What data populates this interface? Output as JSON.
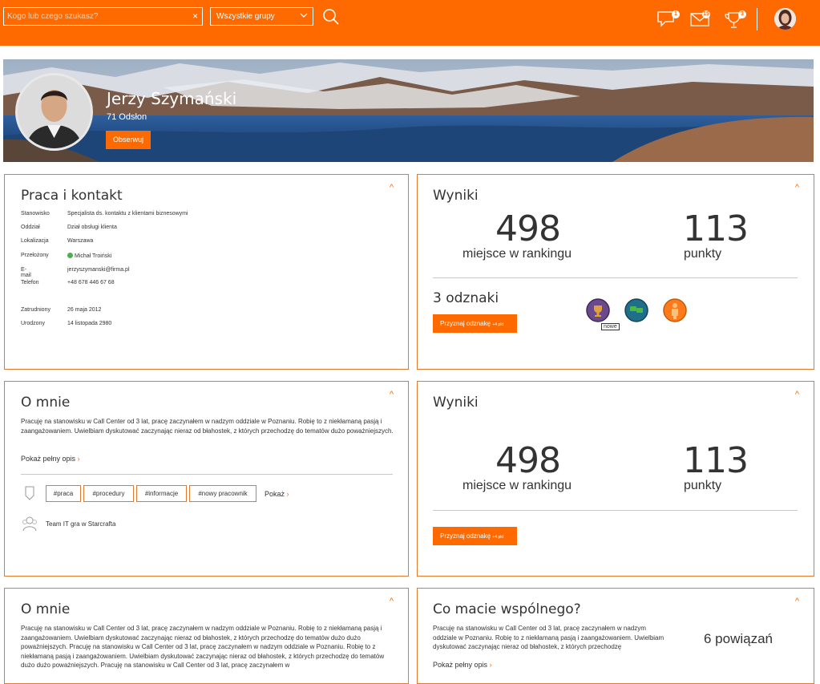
{
  "topbar": {
    "search_placeholder": "Kogo lub czego szukasz?",
    "clear_icon": "×",
    "group_select": "Wszystkie grupy",
    "chevron_icon": "⌄",
    "badges": {
      "comments": "1",
      "messages": "15",
      "trophy": "3"
    },
    "icons": [
      "search-icon",
      "comment-icon",
      "mail-icon",
      "trophy-icon",
      "avatar"
    ]
  },
  "profile": {
    "name": "Jerzy Szymański",
    "views": "71 Odsłon",
    "follow_label": "Obserwuj"
  },
  "work": {
    "title": "Praca i kontakt",
    "rows": [
      {
        "label": "Stanowisko",
        "value": "Specjalista ds. kontaktu z klientami biznesowymi"
      },
      {
        "label": "Oddział",
        "value": "Dział obsługi klienta"
      },
      {
        "label": "Lokalizacja",
        "value": "Warszawa"
      },
      {
        "label": "Przełożony",
        "value": "Michał Troiński"
      },
      {
        "label": "E-mail",
        "value": "jerzyszymanski@firma.pl"
      },
      {
        "label": "Telefon",
        "value": "+48 678 446 67 68"
      },
      {
        "label": "Zatrudniony",
        "value": "26 maja 2012"
      },
      {
        "label": "Urodzony",
        "value": "14 listopada 2980"
      }
    ]
  },
  "results1": {
    "title": "Wyniki",
    "rank_value": "498",
    "rank_label": "miejsce w rankingu",
    "points_value": "113",
    "points_label": "punkty",
    "badges_title": "3 odznaki",
    "grant_label": "Przyznaj odznakę",
    "grant_suffix": "+4 pkt",
    "new_label": "nowe",
    "colors": {
      "badge1": "#6a4a8c",
      "badge2": "#1f6f8b",
      "badge3": "#ff7a1a"
    }
  },
  "about1": {
    "title": "O mnie",
    "text": "Pracuję na stanowisku w Call Center od 3 lat, pracę zaczynałem w nadzym oddziale w Poznaniu. Robię to z niekłamaną pasją i zaangażowaniem. Uwielbiam dyskutować zaczynając nieraz od błahostek, z których przechodzę do tematów dużo poważniejszych.",
    "show_more": "Pokaż pełny opis",
    "tags": [
      "#praca",
      "#procedury",
      "#informacje",
      "#nowy pracownik"
    ],
    "tags_more": "Pokaż",
    "group": "Team IT gra w Starcrafta"
  },
  "results2": {
    "title": "Wyniki",
    "rank_value": "498",
    "rank_label": "miejsce w rankingu",
    "points_value": "113",
    "points_label": "punkty",
    "grant_label": "Przyznaj odznakę",
    "grant_suffix": "+4 pkt"
  },
  "about2": {
    "title": "O mnie",
    "text": "Pracuję na stanowisku w Call Center od 3 lat, pracę zaczynałem w nadzym oddziale w Poznaniu. Robię to z niekłamaną pasją i zaangażowaniem. Uwielbiam dyskutować zaczynając nieraz od błahostek, z których przechodzę do tematów dużo dużo poważniejszych. Pracuję na stanowisku w Call Center od 3 lat, pracę zaczynałem w nadzym oddziale w Poznaniu. Robię to z niekłamaną pasją i zaangażowaniem. Uwielbiam dyskutować zaczynając nieraz od błahostek, z których przechodzę do tematów dużo dużo poważniejszych. Pracuję na stanowisku w Call Center od 3 lat, pracę zaczynałem w"
  },
  "common": {
    "title": "Co macie wspólnego?",
    "text": "Pracuję na stanowisku w Call Center od 3 lat, pracę zaczynałem w nadzym oddziale w Poznaniu. Robię to z niekłamaną pasją i zaangażowaniem. Uwielbiam dyskutować zaczynając nieraz od błahostek, z których przechodzę",
    "connections": "6 powiązań",
    "show_more": "Pokaż pełny opis"
  },
  "collapse_icon": "^",
  "chevron_right": "›"
}
